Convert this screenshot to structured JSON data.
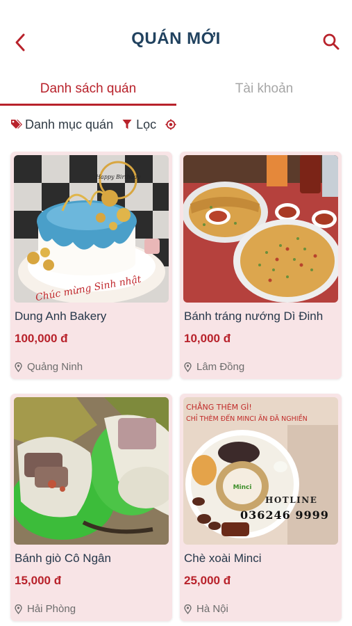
{
  "header": {
    "title": "QUÁN MỚI"
  },
  "tabs": [
    {
      "label": "Danh sách quán"
    },
    {
      "label": "Tài khoản"
    }
  ],
  "filters": {
    "category_label": "Danh mục quán",
    "filter_label": "Lọc"
  },
  "colors": {
    "accent": "#b8222b",
    "title": "#21425f",
    "card_bg": "#f8e4e6"
  },
  "shops": [
    {
      "name": "Dung Anh Bakery",
      "price": "100,000 đ",
      "location": "Quảng Ninh"
    },
    {
      "name": "Bánh tráng nướng Dì Đinh",
      "price": "10,000 đ",
      "location": "Lâm Đồng"
    },
    {
      "name": "Bánh giò Cô Ngân",
      "price": "15,000 đ",
      "location": "Hải Phòng"
    },
    {
      "name": "Chè xoài Minci",
      "price": "25,000 đ",
      "location": "Hà Nội"
    }
  ],
  "image_text": {
    "cake_topper": "Happy Birthday",
    "cake_script": "Chúc mừng Sinh nhật",
    "minci_line1": "CHẲNG THÈM GÌ!",
    "minci_line2": "CHỈ THÈM ĐẾN MINCI ĂN ĐÃ NGHIỀN",
    "minci_hotline_label": "HOTLINE",
    "minci_phone": "036246 9999",
    "minci_logo": "Minci"
  }
}
